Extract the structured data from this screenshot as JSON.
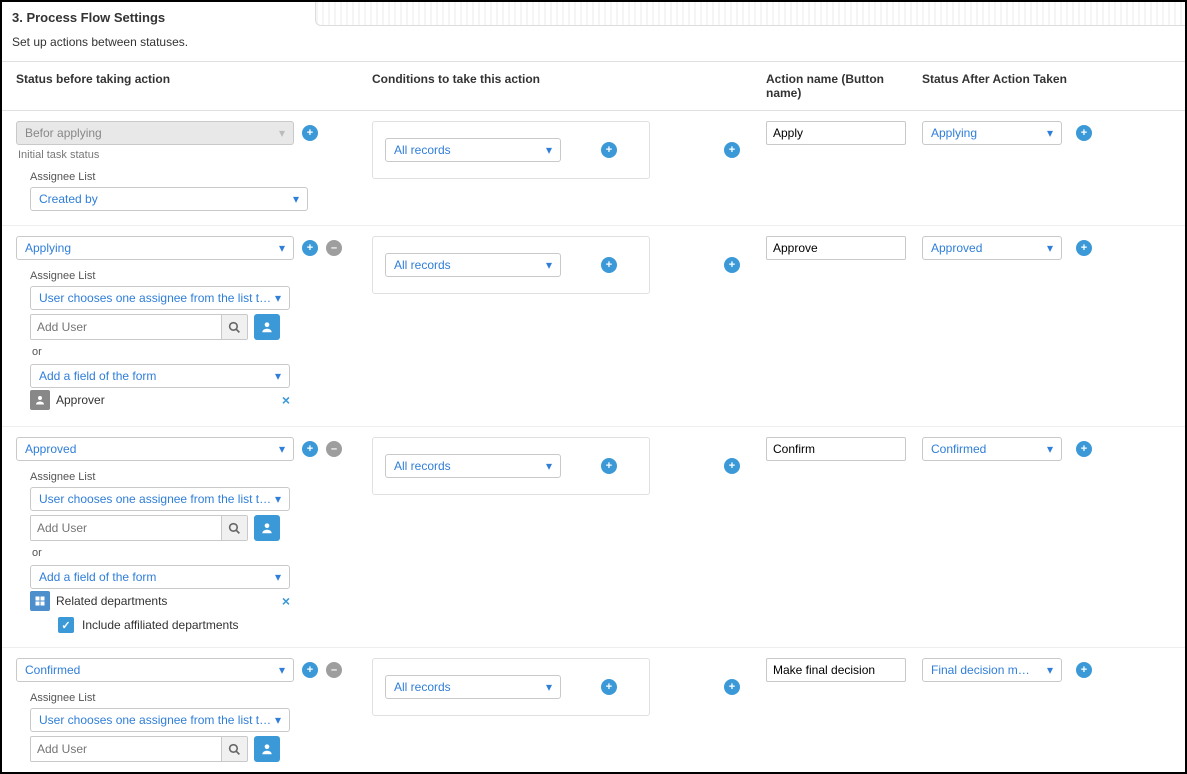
{
  "section": {
    "title": "3. Process Flow Settings",
    "subtitle": "Set up actions between statuses."
  },
  "columns": {
    "status": "Status before taking action",
    "cond": "Conditions to take this action",
    "action": "Action name (Button name)",
    "after": "Status After Action Taken"
  },
  "labels": {
    "assignee_list": "Assignee List",
    "initial_status": "Initial task status",
    "or": "or",
    "add_user_placeholder": "Add User",
    "include_affiliated": "Include affiliated departments"
  },
  "rows": [
    {
      "status": "Befor applying",
      "status_locked": true,
      "can_remove": false,
      "assignee_label": "Assignee List",
      "assignee_drop": "Created by",
      "show_initial_hint": true,
      "cond": "All records",
      "action": "Apply",
      "after": "Applying"
    },
    {
      "status": "Applying",
      "can_remove": true,
      "assignee_drop": "User chooses one assignee from the list t…",
      "add_field_drop": "Add a field of the form",
      "chip_user": "Approver",
      "cond": "All records",
      "action": "Approve",
      "after": "Approved"
    },
    {
      "status": "Approved",
      "can_remove": true,
      "assignee_drop": "User chooses one assignee from the list t…",
      "add_field_drop": "Add a field of the form",
      "chip_org": "Related departments",
      "include_affiliated_checked": true,
      "cond": "All records",
      "action": "Confirm",
      "after": "Confirmed"
    },
    {
      "status": "Confirmed",
      "can_remove": true,
      "assignee_drop": "User chooses one assignee from the list t…",
      "cond": "All records",
      "action": "Make final decision",
      "after": "Final decision m…",
      "truncated_last": true
    }
  ]
}
